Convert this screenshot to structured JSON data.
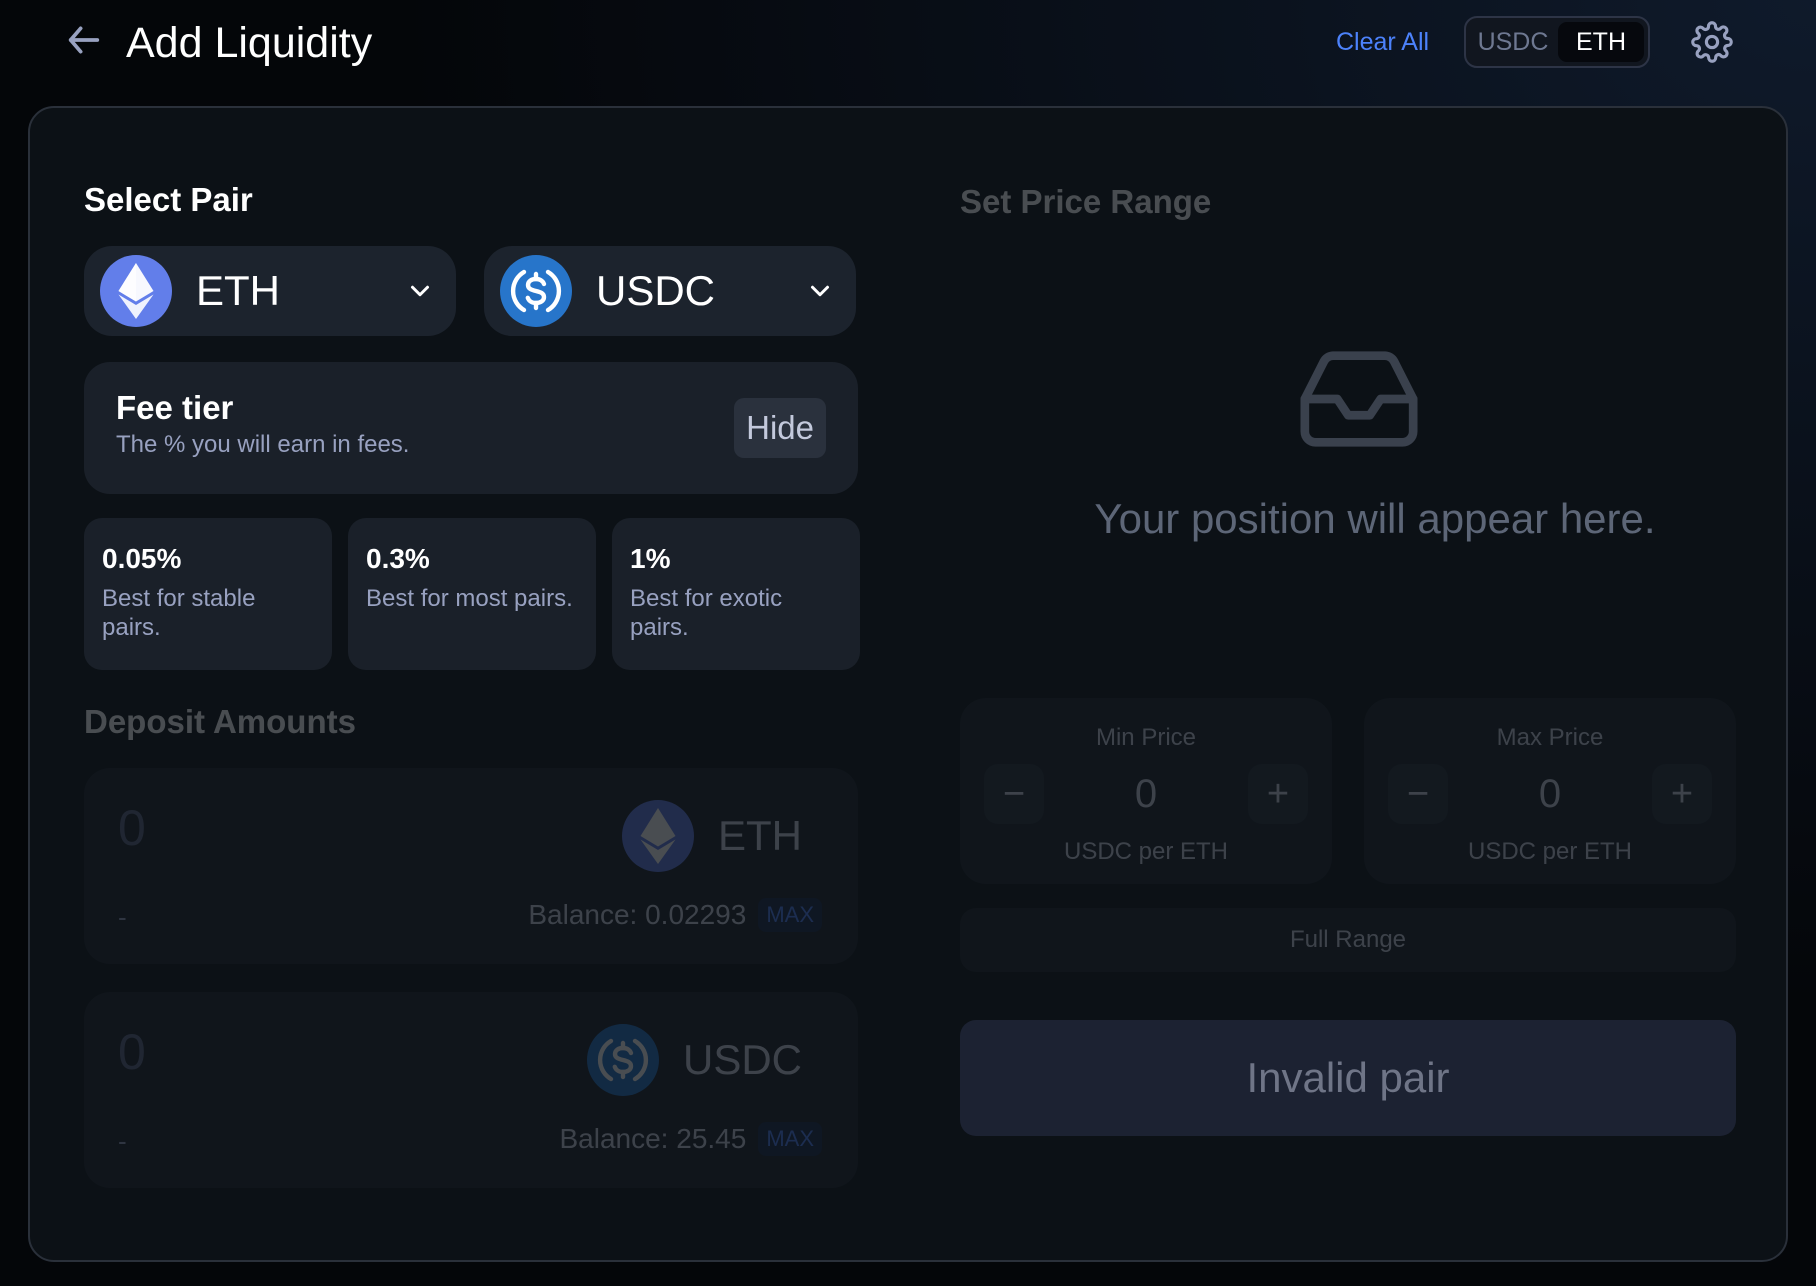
{
  "header": {
    "title": "Add Liquidity",
    "clear_all": "Clear All",
    "toggle": [
      "USDC",
      "ETH"
    ],
    "toggle_active": "ETH"
  },
  "select_pair": {
    "title": "Select Pair",
    "token_a": "ETH",
    "token_b": "USDC"
  },
  "fee_tier": {
    "title": "Fee tier",
    "subtitle": "The % you will earn in fees.",
    "hide_label": "Hide",
    "options": [
      {
        "pct": "0.05%",
        "desc": "Best for stable pairs."
      },
      {
        "pct": "0.3%",
        "desc": "Best for most pairs."
      },
      {
        "pct": "1%",
        "desc": "Best for exotic pairs."
      }
    ]
  },
  "deposit": {
    "title": "Deposit Amounts",
    "items": [
      {
        "amount": "0",
        "usd": "-",
        "token": "ETH",
        "balance": "Balance: 0.02293",
        "max": "MAX"
      },
      {
        "amount": "0",
        "usd": "-",
        "token": "USDC",
        "balance": "Balance: 25.45",
        "max": "MAX"
      }
    ]
  },
  "price_range": {
    "title": "Set Price Range",
    "empty_text": "Your position will appear here.",
    "min": {
      "label": "Min Price",
      "value": "0",
      "unit": "USDC per ETH"
    },
    "max": {
      "label": "Max Price",
      "value": "0",
      "unit": "USDC per ETH"
    },
    "full_range": "Full Range",
    "minus": "−",
    "plus": "+"
  },
  "submit": {
    "label": "Invalid pair"
  },
  "colors": {
    "accent": "#4c82fb",
    "eth_logo": "#627eea",
    "usdc_logo": "#2775ca",
    "card_bg": "#0c1116",
    "panel_bg": "#1c232d"
  },
  "icons": {
    "back": "arrow-left-icon",
    "settings": "gear-icon",
    "chevron": "chevron-down-icon",
    "empty": "inbox-icon",
    "eth": "ethereum-logo-icon",
    "usdc": "usdc-logo-icon"
  }
}
